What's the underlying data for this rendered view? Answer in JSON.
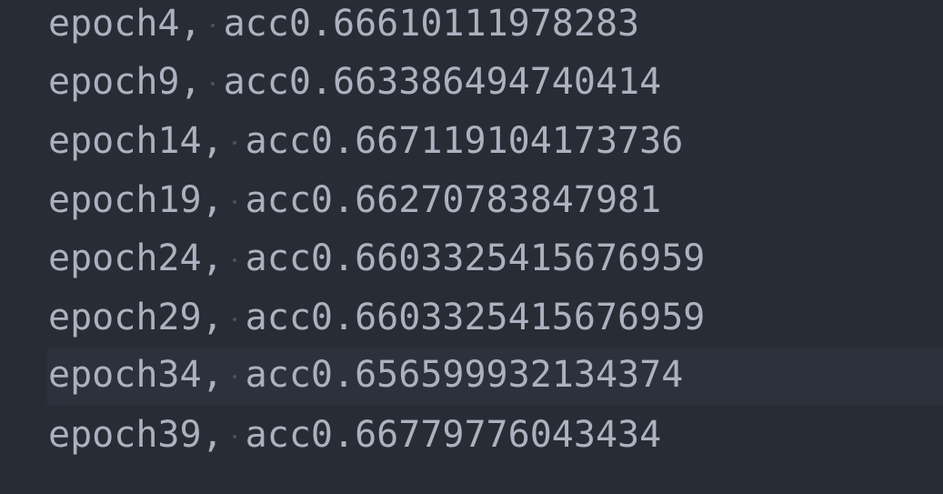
{
  "editor": {
    "lines": [
      {
        "epoch": "epoch4,",
        "acc": "acc0.66610111978283"
      },
      {
        "epoch": "epoch9,",
        "acc": "acc0.663386494740414"
      },
      {
        "epoch": "epoch14,",
        "acc": "acc0.667119104173736"
      },
      {
        "epoch": "epoch19,",
        "acc": "acc0.66270783847981"
      },
      {
        "epoch": "epoch24,",
        "acc": "acc0.6603325415676959"
      },
      {
        "epoch": "epoch29,",
        "acc": "acc0.6603325415676959"
      },
      {
        "epoch": "epoch34,",
        "acc": "acc0.656599932134374"
      },
      {
        "epoch": "epoch39,",
        "acc": "acc0.66779776043434"
      }
    ],
    "active_line_index": 6,
    "colors": {
      "background": "#282c34",
      "text": "#abb2bf",
      "active_line": "#2c313c",
      "whitespace_dot": "#4b5263"
    }
  }
}
